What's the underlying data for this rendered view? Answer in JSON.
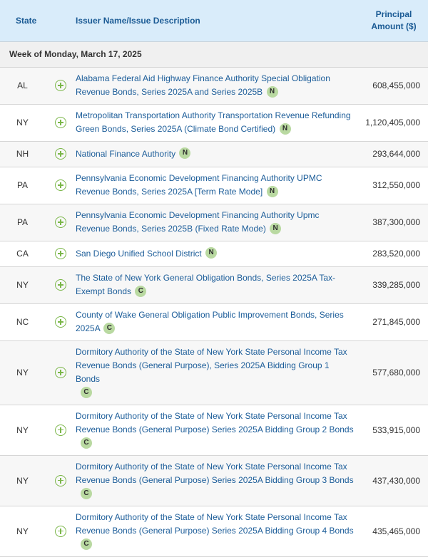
{
  "header": {
    "state": "State",
    "desc": "Issuer Name/Issue Description",
    "amount_line1": "Principal",
    "amount_line2": "Amount ($)"
  },
  "week_label": "Week of Monday, March 17, 2025",
  "rows": [
    {
      "state": "AL",
      "desc": "Alabama Federal Aid Highway Finance Authority Special Obligation Revenue Bonds, Series 2025A and Series 2025B",
      "badge": "N",
      "amount": "608,455,000"
    },
    {
      "state": "NY",
      "desc": "Metropolitan Transportation Authority Transportation Revenue Refunding Green Bonds, Series 2025A (Climate Bond Certified)",
      "badge": "N",
      "amount": "1,120,405,000"
    },
    {
      "state": "NH",
      "desc": "National Finance Authority",
      "badge": "N",
      "amount": "293,644,000"
    },
    {
      "state": "PA",
      "desc": "Pennsylvania Economic Development Financing Authority UPMC Revenue Bonds, Series 2025A [Term Rate Mode]",
      "badge": "N",
      "amount": "312,550,000"
    },
    {
      "state": "PA",
      "desc": "Pennsylvania Economic Development Financing Authority Upmc Revenue Bonds, Series 2025B (Fixed Rate Mode)",
      "badge": "N",
      "amount": "387,300,000"
    },
    {
      "state": "CA",
      "desc": "San Diego Unified School District",
      "badge": "N",
      "amount": "283,520,000"
    },
    {
      "state": "NY",
      "desc": "The State of New York General Obligation Bonds, Series 2025A Tax-Exempt Bonds",
      "badge": "C",
      "amount": "339,285,000"
    },
    {
      "state": "NC",
      "desc": "County of Wake General Obligation Public Improvement Bonds, Series 2025A",
      "badge": "C",
      "amount": "271,845,000"
    },
    {
      "state": "NY",
      "desc": "Dormitory Authority of the State of New York State Personal Income Tax Revenue Bonds (General Purpose), Series 2025A Bidding Group 1 Bonds",
      "badge": "C",
      "amount": "577,680,000"
    },
    {
      "state": "NY",
      "desc": "Dormitory Authority of the State of New York State Personal Income Tax Revenue Bonds (General Purpose) Series 2025A Bidding Group 2 Bonds",
      "badge": "C",
      "amount": "533,915,000"
    },
    {
      "state": "NY",
      "desc": "Dormitory Authority of the State of New York State Personal Income Tax Revenue Bonds (General Purpose) Series 2025A Bidding Group 3 Bonds",
      "badge": "C",
      "amount": "437,430,000"
    },
    {
      "state": "NY",
      "desc": "Dormitory Authority of the State of New York State Personal Income Tax Revenue Bonds (General Purpose) Series 2025A Bidding Group 4 Bonds",
      "badge": "C",
      "amount": "435,465,000"
    }
  ],
  "colors": {
    "header_bg": "#d9ecfa",
    "header_text": "#1a5a94",
    "link": "#1c5d99",
    "badge_bg": "#b9d9a1",
    "plus_icon": "#7ab648"
  },
  "icons": {
    "expand": "plus-circle-icon"
  }
}
